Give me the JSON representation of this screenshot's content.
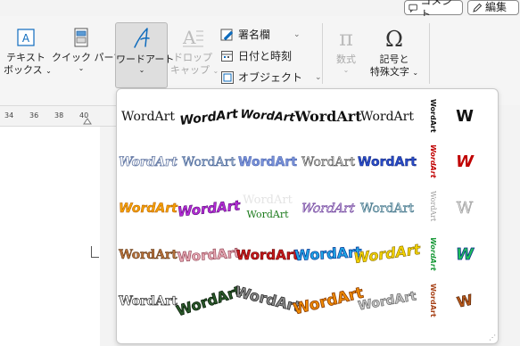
{
  "top": {
    "comment_label": "コメント",
    "edit_label": "編集"
  },
  "ribbon": {
    "textbox": {
      "line1": "テキスト",
      "line2": "ボックス"
    },
    "quickparts": {
      "label": "クイック パーツ"
    },
    "wordart": {
      "label": "ワードアート"
    },
    "dropcap": {
      "line1": "ドロップ",
      "line2": "キャップ"
    },
    "signature": "署名欄",
    "datetime": "日付と時刻",
    "object": "オブジェクト",
    "equation": {
      "label": "数式"
    },
    "symbol": {
      "line1": "記号と",
      "line2": "特殊文字"
    }
  },
  "ruler": {
    "ticks": [
      "34",
      "36",
      "38",
      "40"
    ]
  },
  "gallery": {
    "sample_text": "WordArt",
    "vertical_text": "WordArt",
    "small_text": "W",
    "colors": {
      "accent": "#0f6cbd",
      "orange": "#f5a000",
      "purple": "#8d18c7",
      "green": "#1b7a1b",
      "red": "#c00000"
    }
  }
}
